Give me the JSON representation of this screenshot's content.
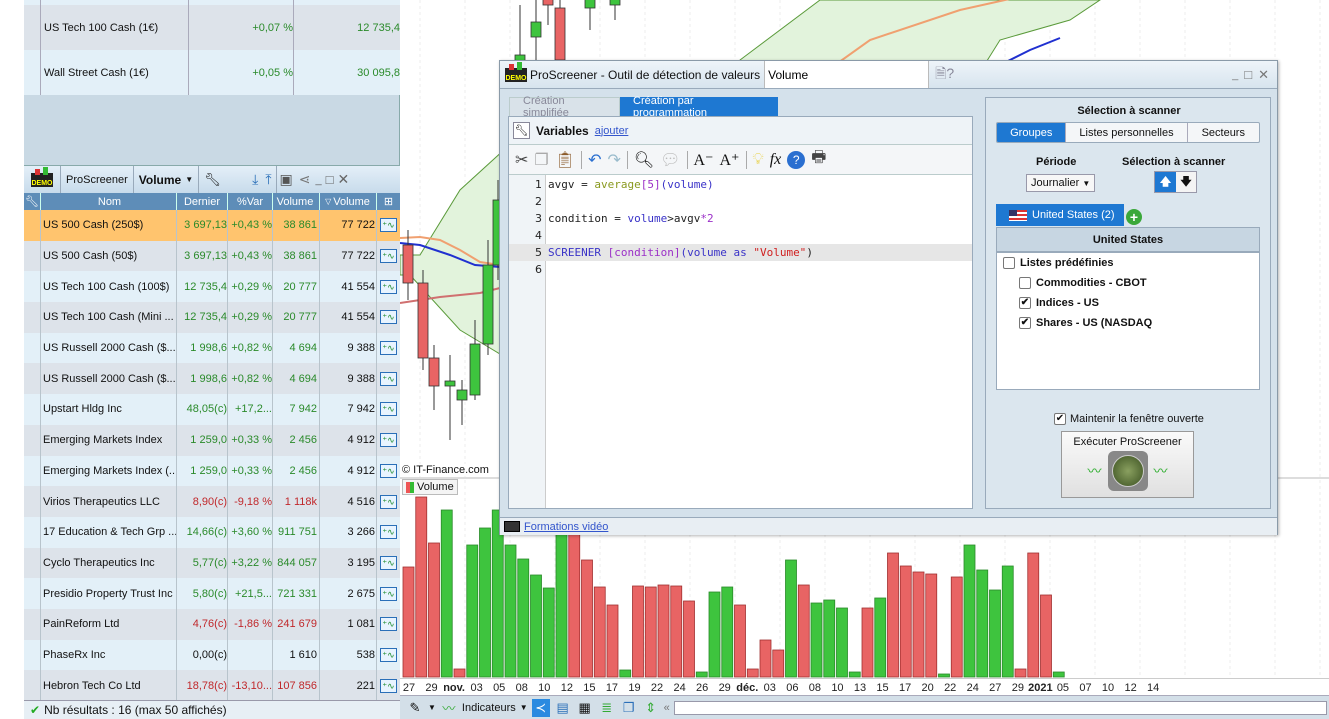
{
  "top_table": {
    "rows": [
      {
        "name": "US Tech 100 Cash (1€)",
        "var": "+0,07 %",
        "value": "12 735,4"
      },
      {
        "name": "Wall Street Cash (1€)",
        "var": "+0,05 %",
        "value": "30 095,8"
      }
    ]
  },
  "screener": {
    "title": "ProScreener",
    "selected": "Volume",
    "demo": "DEMO",
    "columns": [
      "Nom",
      "Dernier",
      "%Var",
      "Volume",
      "Volume"
    ],
    "rows": [
      {
        "name": "US 500 Cash (250$)",
        "last": "3 697,13",
        "var": "+0,43 %",
        "vol": "38 861",
        "vol2": "77 722",
        "dir": "g",
        "selected": true
      },
      {
        "name": "US 500 Cash (50$)",
        "last": "3 697,13",
        "var": "+0,43 %",
        "vol": "38 861",
        "vol2": "77 722",
        "dir": "g"
      },
      {
        "name": "US Tech 100 Cash (100$)",
        "last": "12 735,4",
        "var": "+0,29 %",
        "vol": "20 777",
        "vol2": "41 554",
        "dir": "g"
      },
      {
        "name": "US Tech 100 Cash (Mini ...",
        "last": "12 735,4",
        "var": "+0,29 %",
        "vol": "20 777",
        "vol2": "41 554",
        "dir": "g"
      },
      {
        "name": "US Russell 2000 Cash ($...",
        "last": "1 998,6",
        "var": "+0,82 %",
        "vol": "4 694",
        "vol2": "9 388",
        "dir": "g"
      },
      {
        "name": "US Russell 2000 Cash ($...",
        "last": "1 998,6",
        "var": "+0,82 %",
        "vol": "4 694",
        "vol2": "9 388",
        "dir": "g"
      },
      {
        "name": "Upstart Hldg Inc",
        "last": "48,05(c)",
        "var": "+17,2...",
        "vol": "7 942",
        "vol2": "7 942",
        "dir": "g"
      },
      {
        "name": "Emerging Markets Index",
        "last": "1 259,0",
        "var": "+0,33 %",
        "vol": "2 456",
        "vol2": "4 912",
        "dir": "g"
      },
      {
        "name": "Emerging Markets Index (...",
        "last": "1 259,0",
        "var": "+0,33 %",
        "vol": "2 456",
        "vol2": "4 912",
        "dir": "g"
      },
      {
        "name": "Virios Therapeutics LLC",
        "last": "8,90(c)",
        "var": "-9,18 %",
        "vol": "1 118k",
        "vol2": "4 516",
        "dir": "r"
      },
      {
        "name": "17 Education & Tech Grp ...",
        "last": "14,66(c)",
        "var": "+3,60 %",
        "vol": "911 751",
        "vol2": "3 266",
        "dir": "g"
      },
      {
        "name": "Cyclo Therapeutics Inc",
        "last": "5,77(c)",
        "var": "+3,22 %",
        "vol": "844 057",
        "vol2": "3 195",
        "dir": "g"
      },
      {
        "name": "Presidio Property Trust Inc",
        "last": "5,80(c)",
        "var": "+21,5...",
        "vol": "721 331",
        "vol2": "2 675",
        "dir": "g"
      },
      {
        "name": "PainReform Ltd",
        "last": "4,76(c)",
        "var": "-1,86 %",
        "vol": "241 679",
        "vol2": "1 081",
        "dir": "r"
      },
      {
        "name": "PhaseRx Inc",
        "last": "0,00(c)",
        "var": "",
        "vol": "1 610",
        "vol2": "538",
        "dir": "n"
      },
      {
        "name": "Hebron Tech Co Ltd",
        "last": "18,78(c)",
        "var": "-13,10...",
        "vol": "107 856",
        "vol2": "221",
        "dir": "r"
      }
    ],
    "footer": "Nb résultats : 16 (max 50 affichés)"
  },
  "chart": {
    "copyright": "© IT-Finance.com",
    "volume_label": "Volume",
    "dates": [
      {
        "t": "27"
      },
      {
        "t": "29"
      },
      {
        "t": "nov.",
        "b": true
      },
      {
        "t": "03"
      },
      {
        "t": "05"
      },
      {
        "t": "08"
      },
      {
        "t": "10"
      },
      {
        "t": "12"
      },
      {
        "t": "15"
      },
      {
        "t": "17"
      },
      {
        "t": "19"
      },
      {
        "t": "22"
      },
      {
        "t": "24"
      },
      {
        "t": "26"
      },
      {
        "t": "29"
      },
      {
        "t": "déc.",
        "b": true
      },
      {
        "t": "03"
      },
      {
        "t": "06"
      },
      {
        "t": "08"
      },
      {
        "t": "10"
      },
      {
        "t": "13"
      },
      {
        "t": "15"
      },
      {
        "t": "17"
      },
      {
        "t": "20"
      },
      {
        "t": "22"
      },
      {
        "t": "24"
      },
      {
        "t": "27"
      },
      {
        "t": "29"
      },
      {
        "t": "2021",
        "b": true
      },
      {
        "t": "05"
      },
      {
        "t": "07"
      },
      {
        "t": "10"
      },
      {
        "t": "12"
      },
      {
        "t": "14"
      }
    ],
    "colors": {
      "up": "#3ec43e",
      "down": "#e86464",
      "band": "#e2f3dc"
    }
  },
  "bottom_toolbar": {
    "indicators": "Indicateurs"
  },
  "dialog": {
    "title": "ProScreener - Outil de détection de valeurs",
    "name_value": "Volume",
    "tabs": [
      "Création simplifiée",
      "Création par programmation"
    ],
    "variables": "Variables",
    "add": "ajouter",
    "code_lines": [
      "1",
      "2",
      "3",
      "4",
      "5",
      "6"
    ],
    "code": {
      "l1": [
        "avgv = ",
        "average",
        "[5]",
        "(volume)"
      ],
      "l3": [
        "condition = ",
        "volume",
        ">avgv",
        "*2"
      ],
      "l5": [
        "SCREENER",
        " [condition]",
        "(volume",
        " as ",
        "\"Volume\"",
        ")"
      ]
    },
    "videos": "Formations vidéo",
    "right": {
      "heading": "Sélection à scanner",
      "segments": [
        "Groupes",
        "Listes personnelles",
        "Secteurs"
      ],
      "period_label": "Période",
      "period_value": "Journalier",
      "scan_label": "Sélection à scanner",
      "country_tab": "United States (2)",
      "list_header": "United States",
      "items": [
        {
          "label": "Listes prédéfinies",
          "checked": false
        },
        {
          "label": "Commodities - CBOT",
          "checked": false
        },
        {
          "label": "Indices - US",
          "checked": true
        },
        {
          "label": "Shares - US (NASDAQ",
          "checked": true
        }
      ],
      "keep_open": "Maintenir la fenêtre ouverte",
      "run": "Exécuter ProScreener"
    }
  }
}
